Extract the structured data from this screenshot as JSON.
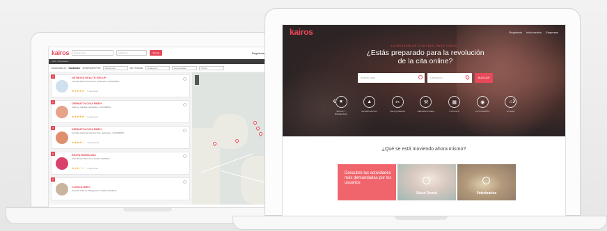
{
  "back_app": {
    "logo": "kairos",
    "search_placeholder": "Buscar aquí",
    "location_placeholder": "Ubicación",
    "search_button": "Buscar",
    "register_link": "Registrate",
    "login_link": "Inicia sesión",
    "breadcrumb": "Inicio / Resultados",
    "filters": {
      "intro": "Mostrando en",
      "place": "Santander",
      "type_label": "ORDENAR POR",
      "type_value": "Relevancia",
      "activity_label": "ACTIVIDAD",
      "activity_value": "Cualquiera",
      "specialty_value": "Especialidad",
      "price_value": "Precio"
    },
    "results": [
      {
        "num": "1",
        "name": "NETBOSS HEALTH GROUP",
        "address": "Avenida Reina Victoria 12, Santander, CANTABRIA",
        "stars": "★★★★★",
        "reviews": "5 opiniones",
        "thumb_color": "#cfe0ee"
      },
      {
        "num": "2",
        "name": "DERMATOLOGIA MBEH",
        "address": "Calle La Cabada, Santander, CANTABRIA",
        "stars": "★★★★★",
        "reviews": "2 opiniones",
        "thumb_color": "#e7a28a"
      },
      {
        "num": "3",
        "name": "DERMATOLOGIA MBEH",
        "address": "Avenida Cardenal Herrera Oria, Santander, CANTABRIA",
        "stars": "★★★★☆",
        "reviews": "12 opiniones",
        "thumb_color": "#e08f6e"
      },
      {
        "num": "4",
        "name": "BEATA MARIA ANA",
        "address": "Calle Beata María Ana, Madrid, MADRID",
        "stars": "★★★☆☆",
        "reviews": "3 opiniones",
        "thumb_color": "#d9416a"
      },
      {
        "num": "5",
        "name": "CLINICA MBE7",
        "address": "Avenida Calle de Málaga Dora, Madrid, BIZKAIA",
        "stars": "",
        "reviews": "",
        "thumb_color": "#c9b49f"
      }
    ]
  },
  "front_app": {
    "logo": "kairos",
    "nav": [
      "Regístrate",
      "Inicia sesión",
      "Empresas"
    ],
    "kicker": "LA REVISIÓN DE CITA FÁCIL PARA TODOS",
    "headline": "¿Estás preparado para la revolución de la cita online?",
    "search_placeholder": "Buscar aquí",
    "location_placeholder": "Ubicación",
    "search_button": "BUSCAR",
    "categories": [
      {
        "icon": "♥",
        "label": "SALUD Y BIENESTAR"
      },
      {
        "icon": "▲",
        "label": "VETERINARIOS"
      },
      {
        "icon": "✂",
        "label": "PELUQUERÍAS"
      },
      {
        "icon": "⚒",
        "label": "REPARACIONES"
      },
      {
        "icon": "▦",
        "label": "COCINAS"
      },
      {
        "icon": "◉",
        "label": "FOTOGRAFÍA"
      },
      {
        "icon": "⌂",
        "label": "HOGAR"
      }
    ],
    "section_title": "¿Qué se está moviendo ahora mismo?",
    "promo_text": "Descubre las actividades más demandadas por los usuarios",
    "tile2_caption": "Salud Dental",
    "tile3_caption": "Veterinarios"
  },
  "colors": {
    "brand": "#e8495a",
    "promo": "#f0656c"
  }
}
